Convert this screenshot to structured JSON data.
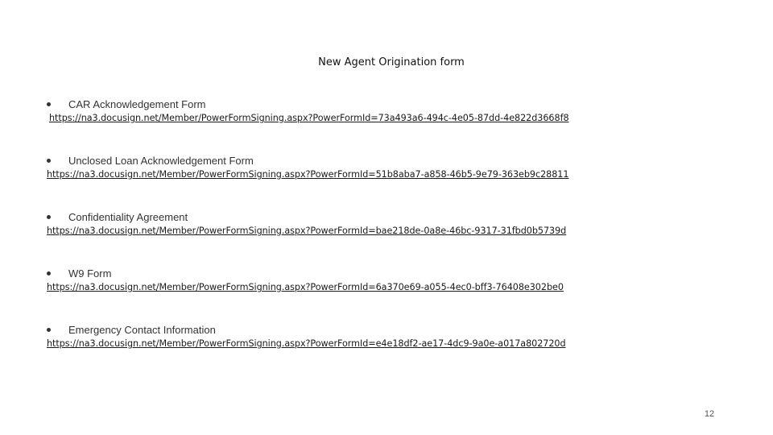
{
  "title": "New Agent Origination form",
  "items": [
    {
      "label": "CAR Acknowledgement Form",
      "url": "https://na3.docusign.net/Member/PowerFormSigning.aspx?PowerFormId=73a493a6-494c-4e05-87dd-4e822d3668f8"
    },
    {
      "label": "Unclosed Loan Acknowledgement Form",
      "url": "https://na3.docusign.net/Member/PowerFormSigning.aspx?PowerFormId=51b8aba7-a858-46b5-9e79-363eb9c28811"
    },
    {
      "label": "Confidentiality Agreement",
      "url": "https://na3.docusign.net/Member/PowerFormSigning.aspx?PowerFormId=bae218de-0a8e-46bc-9317-31fbd0b5739d"
    },
    {
      "label": "W9 Form",
      "url": "https://na3.docusign.net/Member/PowerFormSigning.aspx?PowerFormId=6a370e69-a055-4ec0-bff3-76408e302be0"
    },
    {
      "label": "Emergency Contact Information",
      "url": "https://na3.docusign.net/Member/PowerFormSigning.aspx?PowerFormId=e4e18df2-ae17-4dc9-9a0e-a017a802720d"
    }
  ],
  "page_number": "12"
}
